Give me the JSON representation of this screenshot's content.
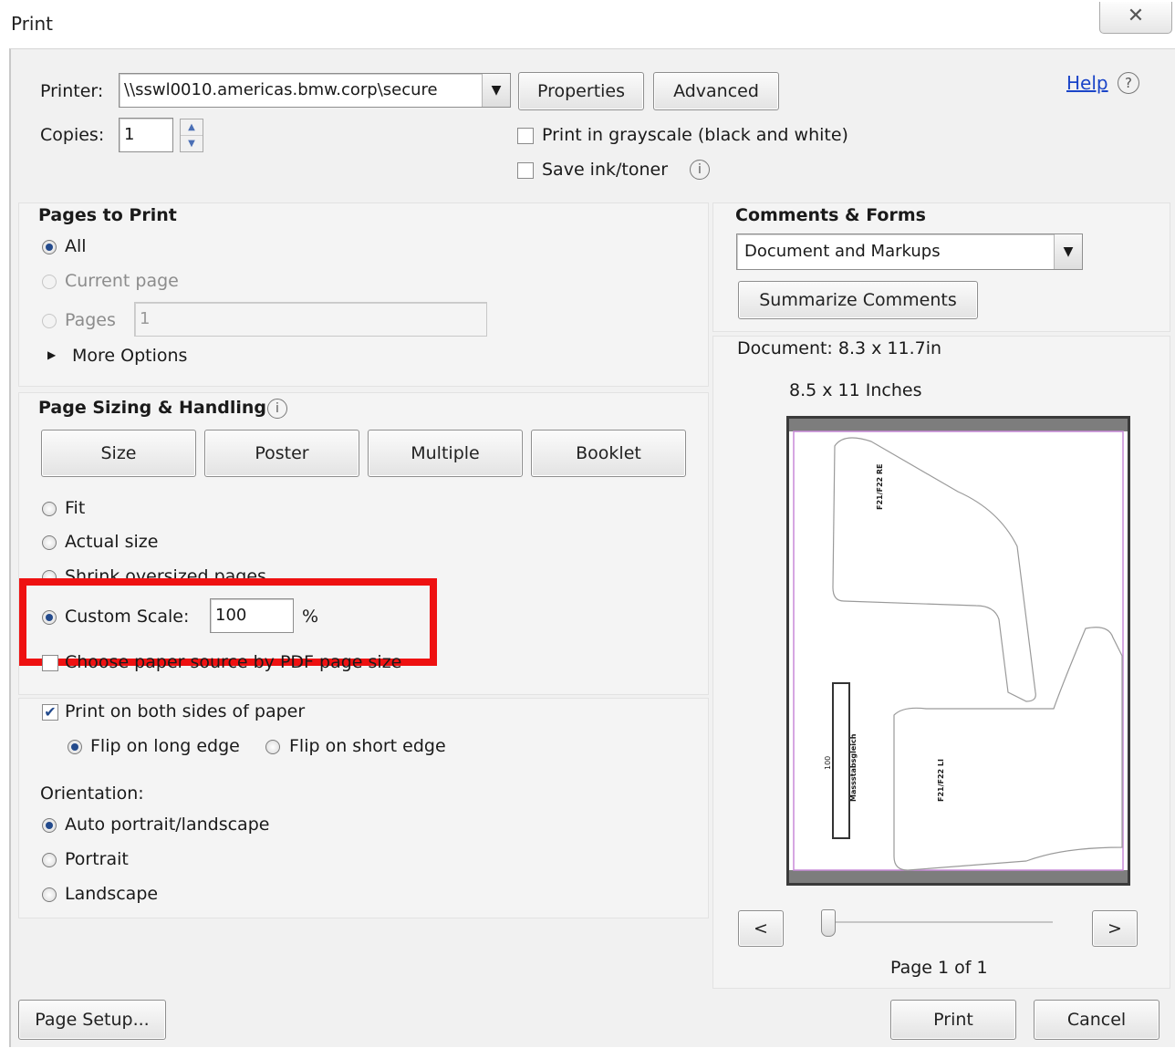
{
  "window": {
    "title": "Print",
    "close_glyph": "✕"
  },
  "printer": {
    "label": "Printer:",
    "selected": "\\\\sswl0010.americas.bmw.corp\\secure",
    "properties_label": "Properties",
    "advanced_label": "Advanced",
    "copies_label": "Copies:",
    "copies_value": "1",
    "grayscale_label": "Print in grayscale (black and white)",
    "grayscale_checked": false,
    "save_ink_label": "Save ink/toner",
    "save_ink_checked": false,
    "help_label": "Help"
  },
  "pages_to_print": {
    "heading": "Pages to Print",
    "all_label": "All",
    "current_label": "Current page",
    "pages_label": "Pages",
    "pages_value": "1",
    "more_options_label": "More Options",
    "selected": "All"
  },
  "sizing": {
    "heading": "Page Sizing & Handling",
    "tabs": [
      "Size",
      "Poster",
      "Multiple",
      "Booklet"
    ],
    "fit_label": "Fit",
    "actual_label": "Actual size",
    "shrink_label": "Shrink oversized pages",
    "custom_label": "Custom Scale:",
    "custom_value": "100",
    "percent_label": "%",
    "paper_source_label": "Choose paper source by PDF page size",
    "selected": "Custom Scale"
  },
  "duplex": {
    "both_sides_label": "Print on both sides of paper",
    "both_sides_checked": true,
    "long_edge_label": "Flip on long edge",
    "short_edge_label": "Flip on short edge",
    "selected": "Flip on long edge"
  },
  "orientation": {
    "heading": "Orientation:",
    "auto_label": "Auto portrait/landscape",
    "portrait_label": "Portrait",
    "landscape_label": "Landscape",
    "selected": "Auto portrait/landscape"
  },
  "comments": {
    "heading": "Comments & Forms",
    "selected": "Document and Markups",
    "summarize_label": "Summarize Comments"
  },
  "preview": {
    "document_size": "Document: 8.3 x 11.7in",
    "paper_size": "8.5 x 11 Inches",
    "prev_label": "<",
    "next_label": ">",
    "page_indicator": "Page 1 of 1",
    "part_labels": [
      "F21/F22 RE",
      "F21/F22 LI"
    ],
    "scale_label": "100",
    "scale_name": "Massstabsgleich",
    "zoom_fraction": 0.0
  },
  "footer": {
    "page_setup_label": "Page Setup...",
    "print_label": "Print",
    "cancel_label": "Cancel"
  },
  "colors": {
    "highlight": "#ee1111",
    "link": "#1a44c8",
    "radio_dot": "#234a8c",
    "page_margin": "#d8d0e0"
  }
}
